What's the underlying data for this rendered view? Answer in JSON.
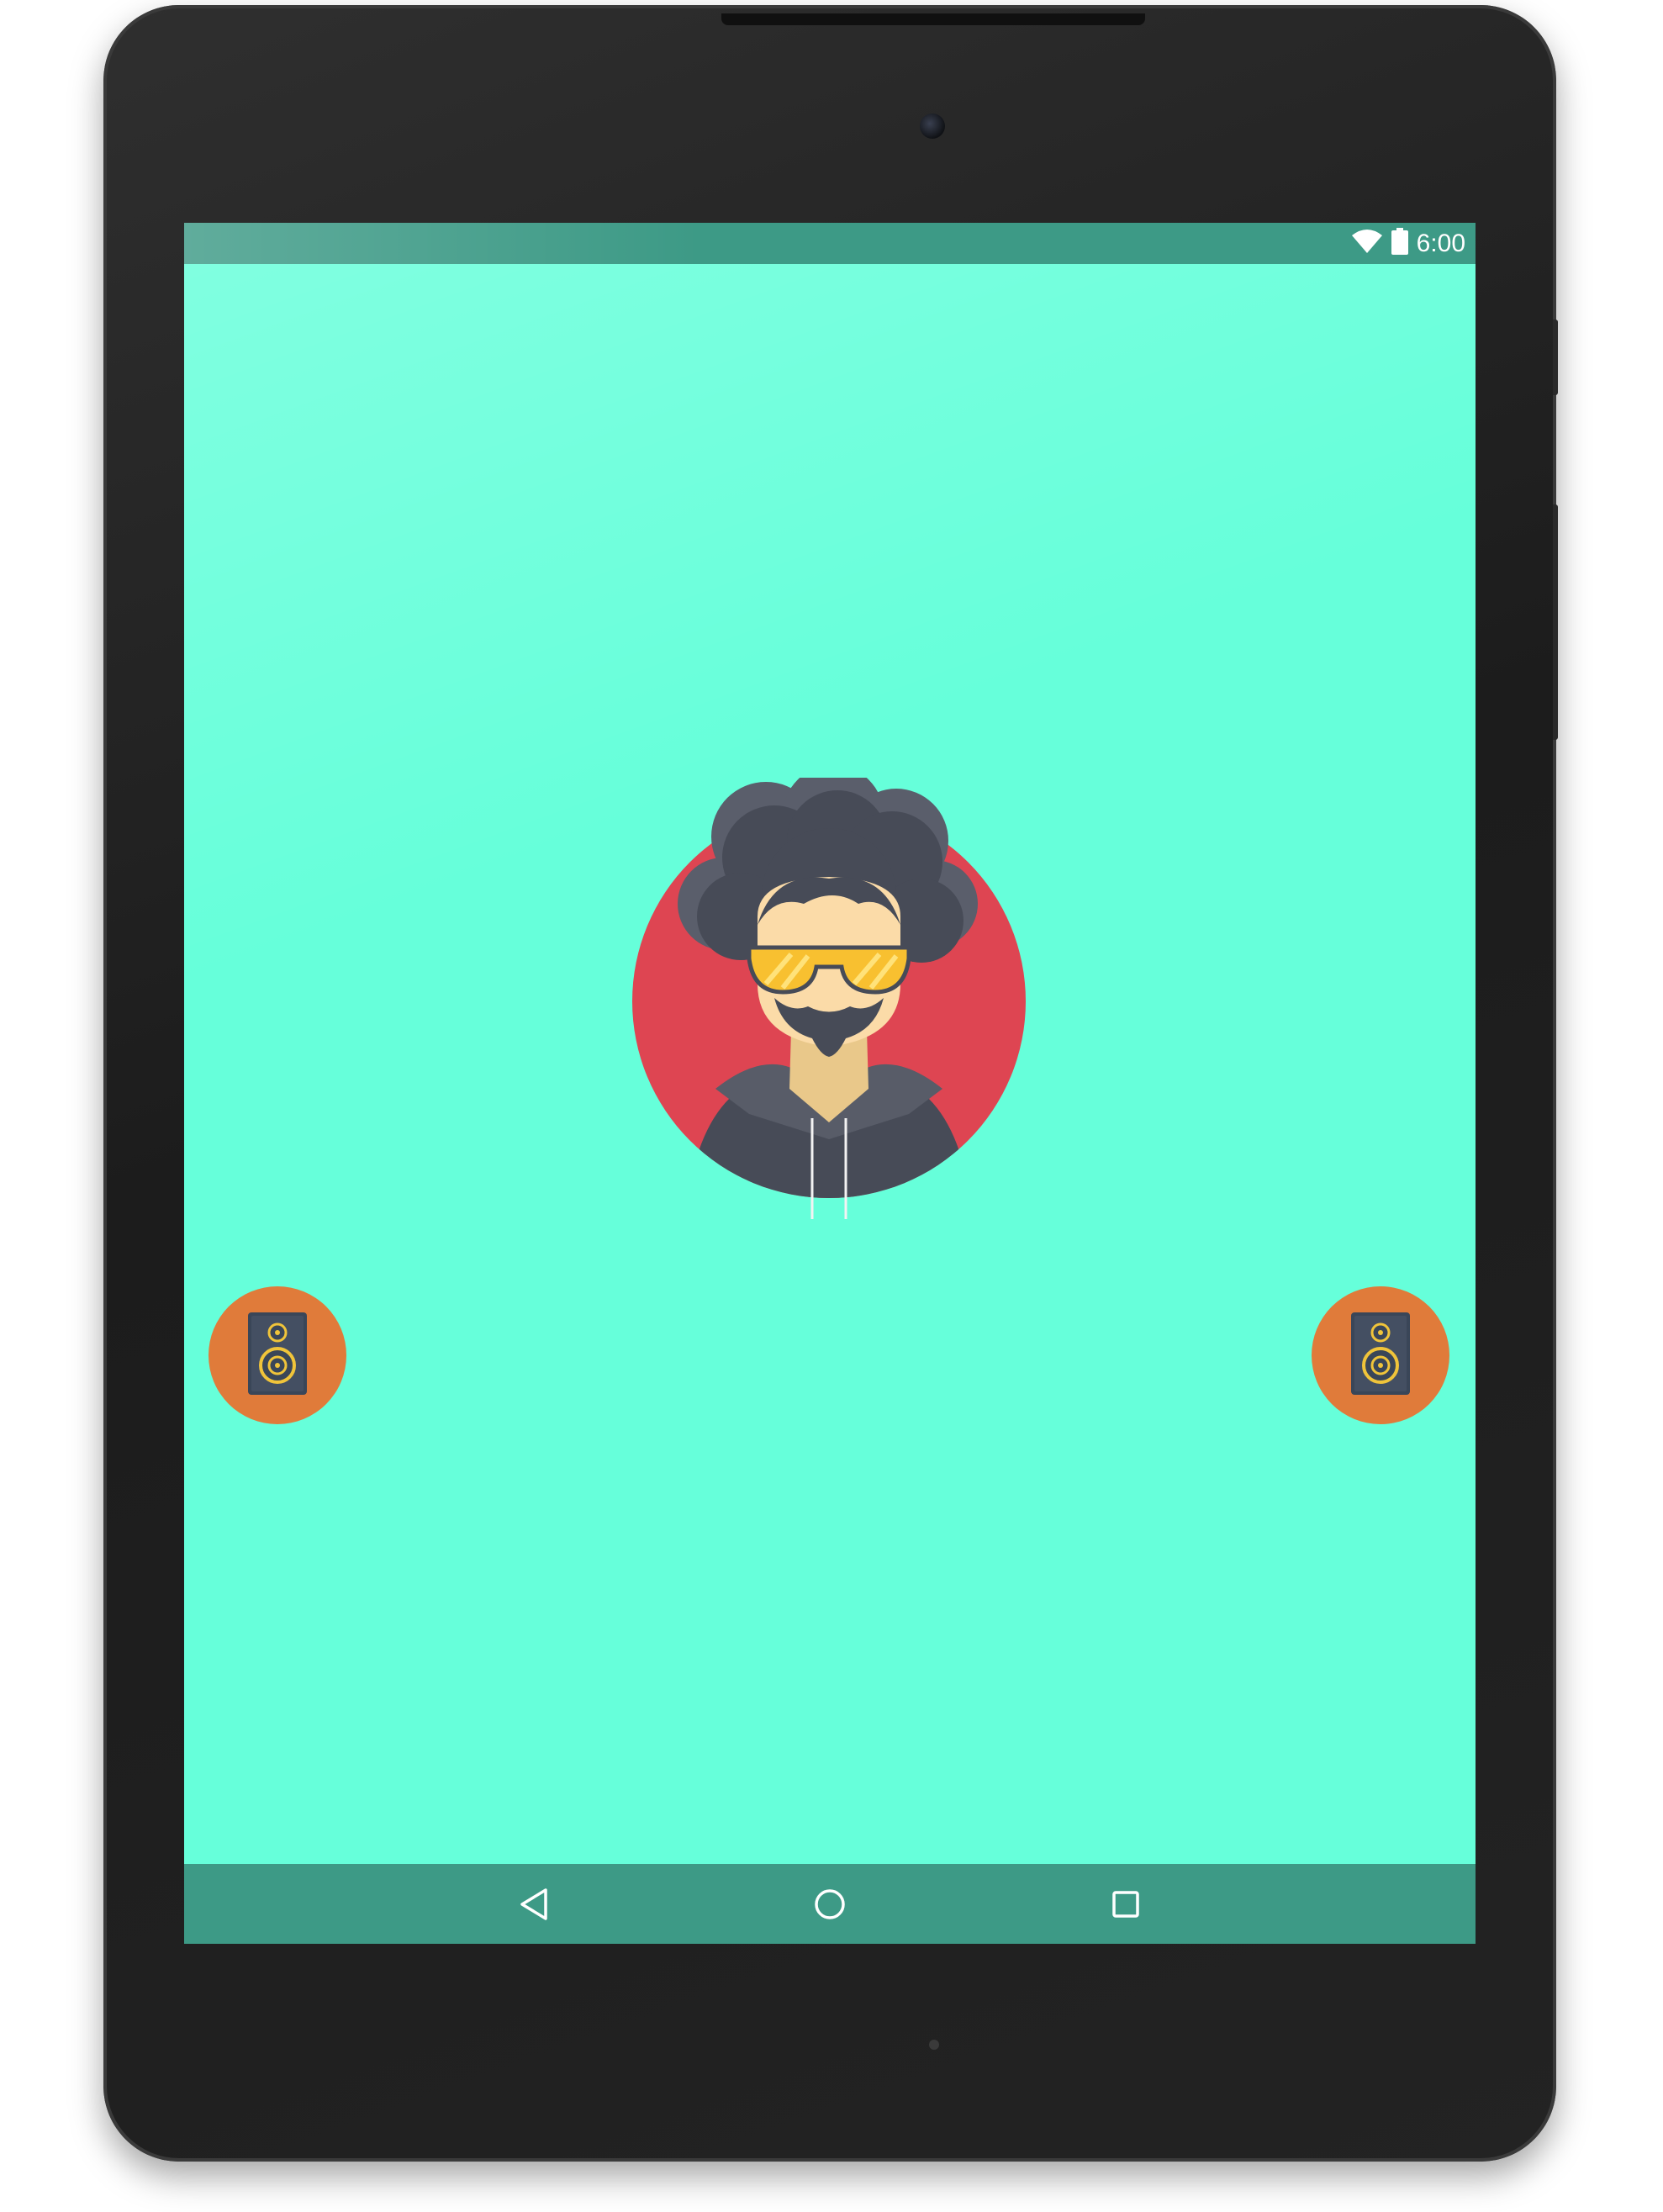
{
  "status_bar": {
    "time": "6:00",
    "wifi_icon": "wifi-icon",
    "battery_icon": "battery-icon"
  },
  "main": {
    "avatar_icon": "dj-avatar-icon",
    "left_speaker_icon": "speaker-icon",
    "right_speaker_icon": "speaker-icon"
  },
  "nav_bar": {
    "back_icon": "back-icon",
    "home_icon": "home-icon",
    "recents_icon": "recents-icon"
  },
  "colors": {
    "background": "#66ffda",
    "bars": "#3d9a86",
    "avatar_circle": "#de4552",
    "speaker_button": "#e07b3a",
    "hair": "#474b57",
    "glasses": "#f8c030",
    "skin": "#fbdba8"
  }
}
